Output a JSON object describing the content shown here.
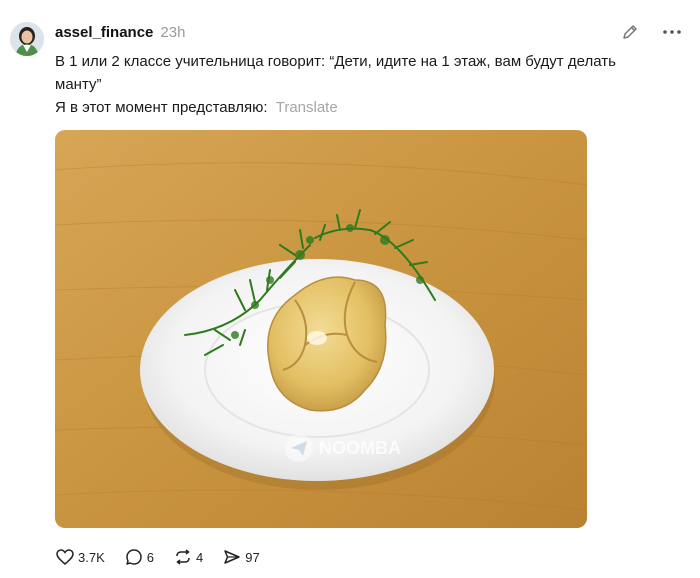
{
  "post": {
    "username": "assel_finance",
    "timestamp": "23h",
    "text_line_1": "В 1 или 2 классе учительница говорит: “Дети, идите на 1 этаж, вам будут делать манту”",
    "text_line_2": "Я в этот момент представляю:",
    "translate_label": "Translate",
    "image_watermark": "NOOMBA"
  },
  "actions": {
    "likes": "3.7K",
    "comments": "6",
    "reposts": "4",
    "shares": "97"
  },
  "icons": {
    "edit": "pencil-icon",
    "more": "more-dots-icon",
    "like": "heart-icon",
    "comment": "comment-icon",
    "repost": "repost-icon",
    "share": "share-icon"
  },
  "colors": {
    "text": "#111111",
    "muted": "#9a9a9a",
    "translate": "#a7a7a7",
    "table_wood": "#c9943f",
    "plate": "#f7f7f7",
    "dumpling": "#e6c46a",
    "dill": "#2f7a1f"
  }
}
